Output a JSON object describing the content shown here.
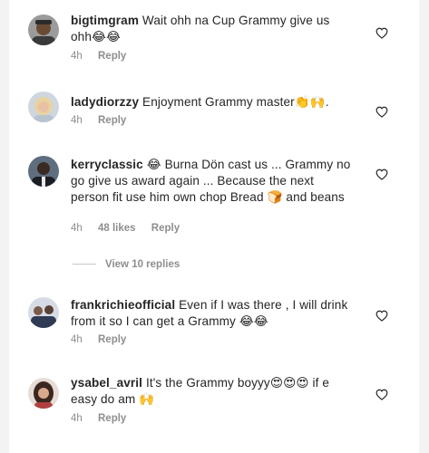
{
  "comments": [
    {
      "username": "bigtimgram",
      "text": "Wait ohh na Cup Grammy give us ohh",
      "emoji": "😂😂",
      "time": "4h",
      "reply_label": "Reply",
      "avatar_icon": "avatar-man-cap-icon"
    },
    {
      "username": "ladydiorzzy",
      "text": "Enjoyment Grammy master",
      "emoji": "👏🙌",
      "trail": ".",
      "time": "4h",
      "reply_label": "Reply",
      "avatar_icon": "avatar-woman-blonde-icon"
    },
    {
      "username": "kerryclassic",
      "emoji_after_user": "😂",
      "text": "Burna Dön cast us ... Grammy no go give us award again ... Because the next person fit use him own chop Bread",
      "emoji": "🍞",
      "trail": "and beans",
      "time": "4h",
      "likes": "48 likes",
      "reply_label": "Reply",
      "avatar_icon": "avatar-man-suit-icon"
    },
    {
      "username": "frankrichieofficial",
      "text": "Even if I was there , I will drink from it so I can get a Grammy",
      "emoji": "😂😂",
      "time": "4h",
      "reply_label": "Reply",
      "avatar_icon": "avatar-group-photo-icon"
    },
    {
      "username": "ysabel_avril",
      "text": "It's the Grammy boyyy",
      "emoji": "😍😍😍",
      "trail": "if e easy do am",
      "emoji2": "🙌",
      "time": "4h",
      "reply_label": "Reply",
      "avatar_icon": "avatar-woman-dark-hair-icon"
    }
  ],
  "view_replies": "View 10 replies",
  "colors": {
    "text": "#262626",
    "meta": "#8e8e8e",
    "background": "#ffffff"
  }
}
